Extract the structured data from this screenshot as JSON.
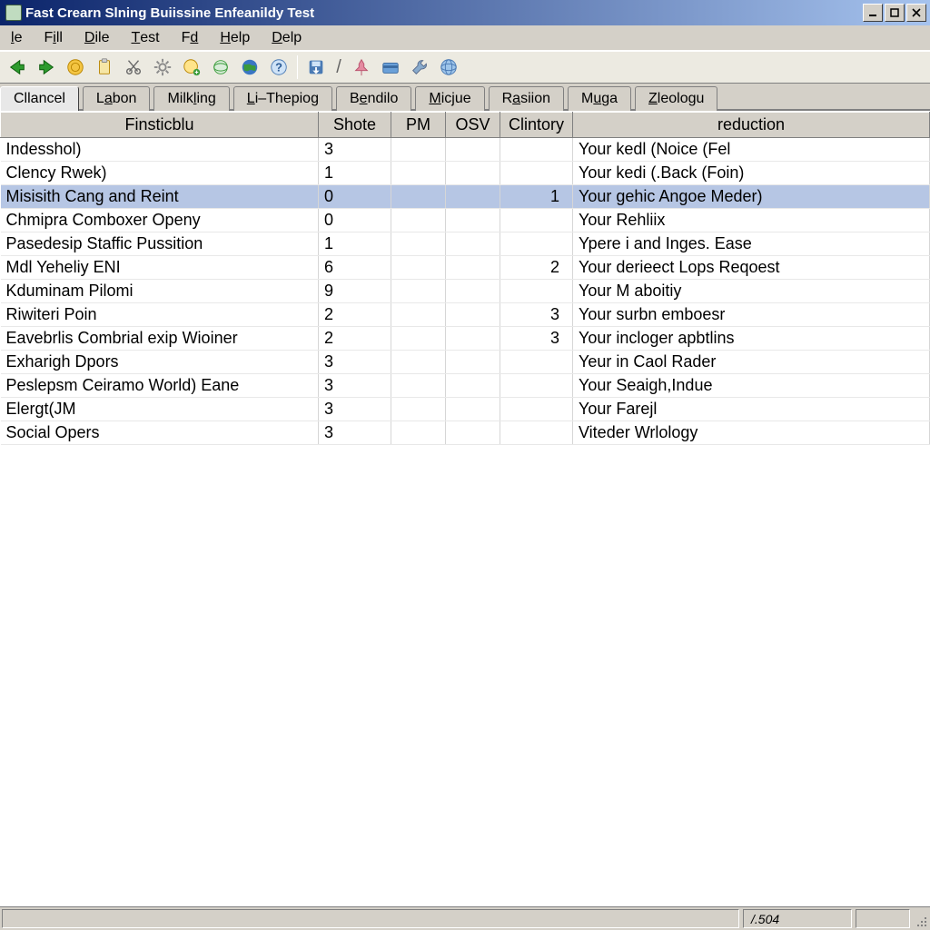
{
  "window": {
    "title": "Fast Crearn Slning Buiissine Enfeanildy Test"
  },
  "menu": {
    "items": [
      {
        "prefix": "",
        "key": "l",
        "rest": "e"
      },
      {
        "prefix": "F",
        "key": "i",
        "rest": "ll"
      },
      {
        "prefix": "",
        "key": "D",
        "rest": "ile"
      },
      {
        "prefix": "",
        "key": "T",
        "rest": "est"
      },
      {
        "prefix": "F",
        "key": "d",
        "rest": ""
      },
      {
        "prefix": "",
        "key": "H",
        "rest": "elp"
      },
      {
        "prefix": "",
        "key": "D",
        "rest": "elp"
      }
    ]
  },
  "tabs": {
    "items": [
      {
        "prefix": "Cl",
        "key": "",
        "rest": "lancel",
        "active": true
      },
      {
        "prefix": "L",
        "key": "a",
        "rest": "bon",
        "active": false
      },
      {
        "prefix": "Milk",
        "key": "l",
        "rest": "ing",
        "active": false
      },
      {
        "prefix": "",
        "key": "L",
        "rest": "i–Thepiog",
        "active": false
      },
      {
        "prefix": "B",
        "key": "e",
        "rest": "ndilo",
        "active": false
      },
      {
        "prefix": "",
        "key": "M",
        "rest": "icjue",
        "active": false
      },
      {
        "prefix": "R",
        "key": "a",
        "rest": "siion",
        "active": false
      },
      {
        "prefix": "M",
        "key": "u",
        "rest": "ga",
        "active": false
      },
      {
        "prefix": "",
        "key": "Z",
        "rest": "leologu",
        "active": false
      }
    ]
  },
  "table": {
    "headers": {
      "name": "Finsticblu",
      "shote": "Shote",
      "pm": "PM",
      "osv": "OSV",
      "clintory": "Clintory",
      "reduction": "reduction"
    },
    "rows": [
      {
        "name": "Indesshol)",
        "shote": "3",
        "pm": "",
        "osv": "",
        "clin": "",
        "red": "Your kedl (Noice (Fel",
        "sel": false
      },
      {
        "name": "Clency Rwek)",
        "shote": "1",
        "pm": "",
        "osv": "",
        "clin": "",
        "red": "Your kedi (.Back (Foin)",
        "sel": false
      },
      {
        "name": "Misisith Cang and Reint",
        "shote": "0",
        "pm": "",
        "osv": "",
        "clin": "1",
        "red": "Your gehic Angoe Meder)",
        "sel": true
      },
      {
        "name": "Chmipra Comboxer Openy",
        "shote": "0",
        "pm": "",
        "osv": "",
        "clin": "",
        "red": "Your Rehliix",
        "sel": false
      },
      {
        "name": "Pasedesip Staffic Pussition",
        "shote": "1",
        "pm": "",
        "osv": "",
        "clin": "",
        "red": "Ypere i and Inges. Ease",
        "sel": false
      },
      {
        "name": "Mdl Yeheliy ENI",
        "shote": "6",
        "pm": "",
        "osv": "",
        "clin": "2",
        "red": "Your derieect Lops Reqoest",
        "sel": false
      },
      {
        "name": "Kduminam Pilomi",
        "shote": "9",
        "pm": "",
        "osv": "",
        "clin": "",
        "red": "Your M aboitiy",
        "sel": false
      },
      {
        "name": "Riwiteri Poin",
        "shote": "2",
        "pm": "",
        "osv": "",
        "clin": "3",
        "red": "Your surbn emboesr",
        "sel": false
      },
      {
        "name": "Eavebrlis Combrial exip Wioiner",
        "shote": "2",
        "pm": "",
        "osv": "",
        "clin": "3",
        "red": "Your incloger apbtlins",
        "sel": false
      },
      {
        "name": "Exharigh Dpors",
        "shote": "3",
        "pm": "",
        "osv": "",
        "clin": "",
        "red": "Yeur in Caol Rader",
        "sel": false
      },
      {
        "name": "Peslepsm Ceiramo World) Eane",
        "shote": "3",
        "pm": "",
        "osv": "",
        "clin": "",
        "red": "Your Seaigh,Indue",
        "sel": false
      },
      {
        "name": "Elergt(JM",
        "shote": "3",
        "pm": "",
        "osv": "",
        "clin": "",
        "red": "Your Farejl",
        "sel": false
      },
      {
        "name": "Social Opers",
        "shote": "3",
        "pm": "",
        "osv": "",
        "clin": "",
        "red": "Viteder Wrlology",
        "sel": false
      }
    ]
  },
  "status": {
    "mid_text": "/.504",
    "small_text": ""
  }
}
